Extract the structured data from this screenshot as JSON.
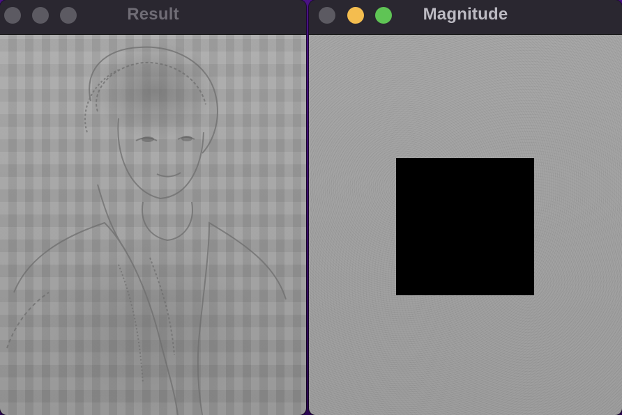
{
  "windows": [
    {
      "title": "Result",
      "controls": {
        "close": "#5c5a62",
        "minimize": "#5c5a62",
        "zoom": "#5c5a62"
      },
      "image": "filtered portrait result"
    },
    {
      "title": "Magnitude",
      "controls": {
        "close": "#5c5a62",
        "minimize": "#f4bd4f",
        "zoom": "#5fc455"
      },
      "image": "fft magnitude spectrum with masked center"
    }
  ],
  "colors": {
    "desktop": "#3b0a6b",
    "titlebar": "#2a2730",
    "mask": "#000000"
  }
}
